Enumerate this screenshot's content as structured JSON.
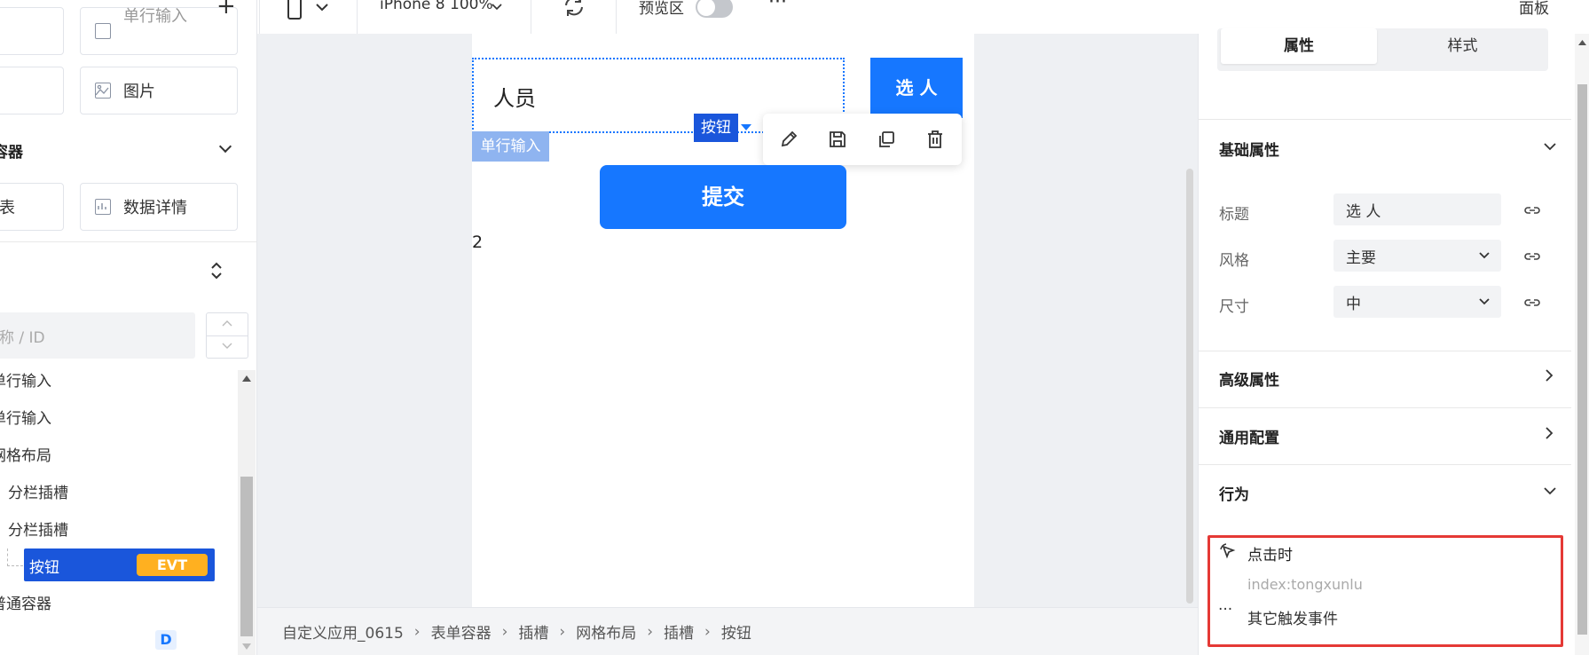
{
  "toolbar": {
    "plus": "+",
    "device": "iPhone 8 100%",
    "preview_label": "预览区",
    "more": "···",
    "panel_label": "面板"
  },
  "left": {
    "cards": [
      {
        "label": "单行输入"
      },
      {
        "label": "图片"
      },
      {
        "label": "列表"
      },
      {
        "label": "数据详情"
      }
    ],
    "section_title": "容器",
    "search_placeholder": "名称 / ID",
    "tree": [
      {
        "label": "单行输入"
      },
      {
        "label": "单行输入"
      },
      {
        "label": "网格布局"
      },
      {
        "label": "分栏插槽"
      },
      {
        "label": "分栏插槽"
      },
      {
        "label": "按钮",
        "badge": "EVT"
      },
      {
        "label": "普通容器"
      }
    ],
    "bottom_badge": "D"
  },
  "canvas": {
    "input_value": "人员",
    "select_btn": "选 人",
    "tag_button": "按钮",
    "tag_input": "单行输入",
    "submit": "提交",
    "number": "2"
  },
  "breadcrumb": [
    "自定义应用_0615",
    "表单容器",
    "插槽",
    "网格布局",
    "插槽",
    "按钮"
  ],
  "panel": {
    "tabs": [
      "属性",
      "样式"
    ],
    "basic": {
      "title": "基础属性",
      "rows": [
        {
          "label": "标题",
          "value": "选 人"
        },
        {
          "label": "风格",
          "value": "主要"
        },
        {
          "label": "尺寸",
          "value": "中"
        }
      ]
    },
    "advanced": "高级属性",
    "common": "通用配置",
    "behavior": {
      "title": "行为",
      "event": "点击时",
      "event_value": "index:tongxunlu",
      "other": "其它触发事件"
    }
  },
  "colors": {
    "primary": "#1677ff",
    "selected_bg": "#1a56db",
    "evt_badge": "#ffb020",
    "highlight_box": "#e53935"
  }
}
